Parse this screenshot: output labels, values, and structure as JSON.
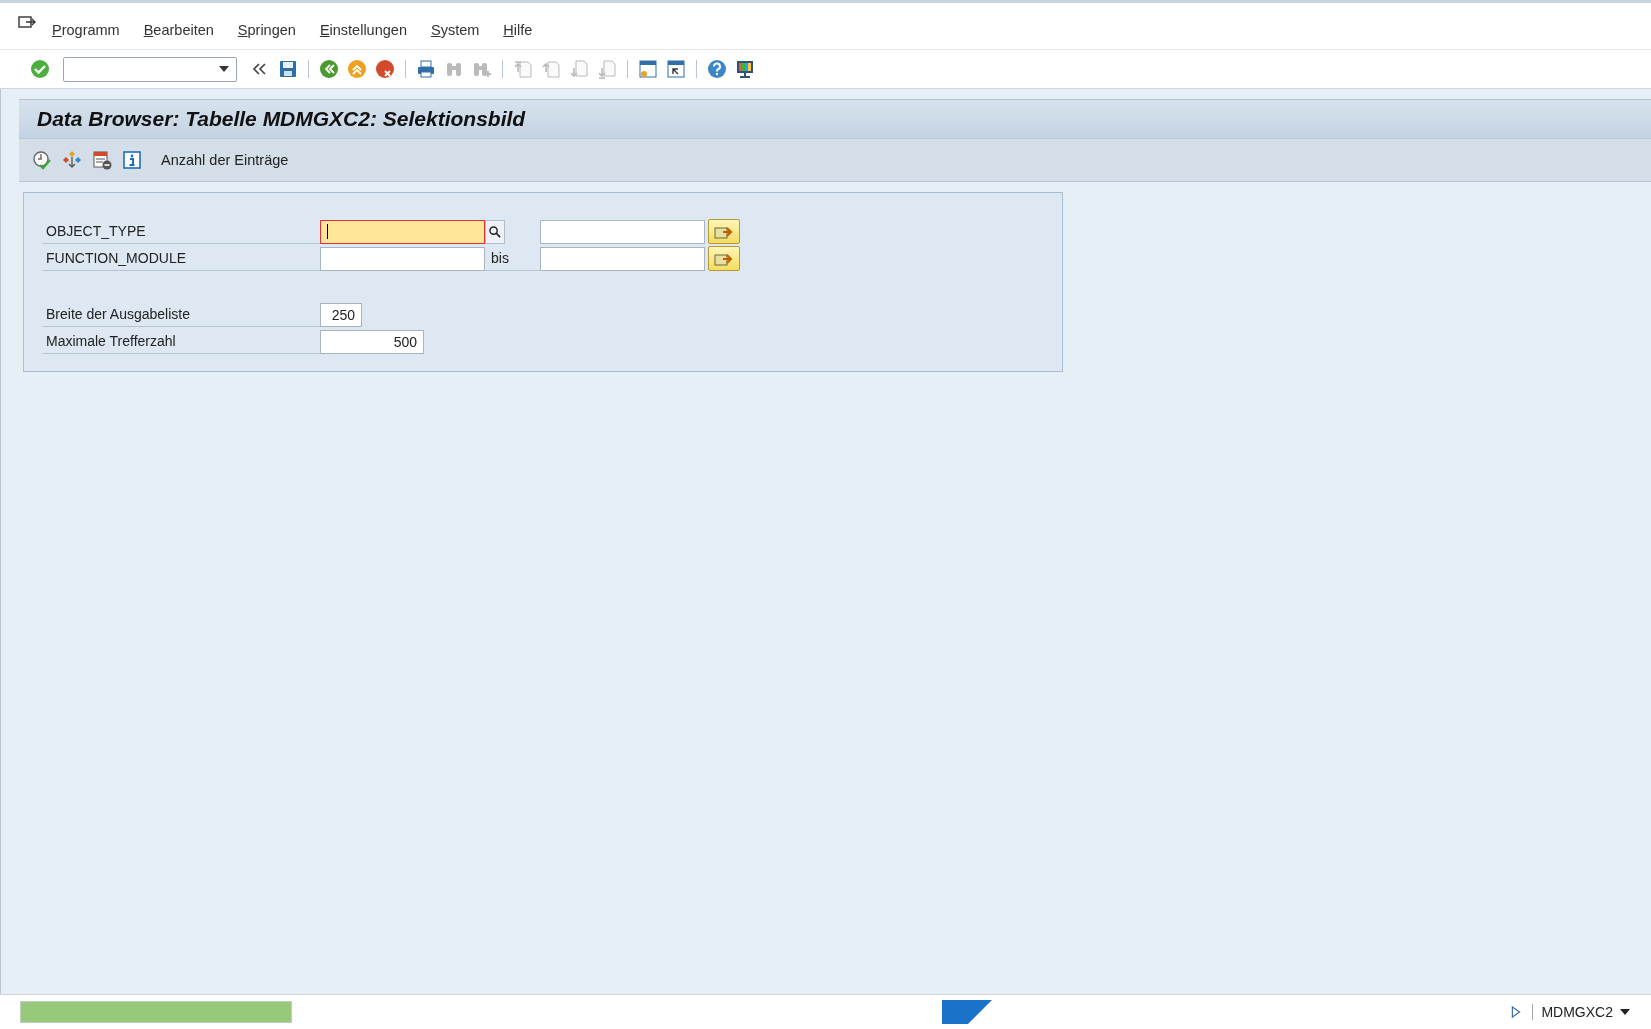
{
  "menu_bar": {
    "items": [
      "Programm",
      "Bearbeiten",
      "Springen",
      "Einstellungen",
      "System",
      "Hilfe"
    ]
  },
  "toolbar": {
    "items": [
      {
        "kind": "enter",
        "disabled": false
      },
      {
        "kind": "command-field"
      },
      {
        "kind": "collapse",
        "disabled": false
      },
      {
        "kind": "save",
        "disabled": false
      },
      {
        "kind": "separator"
      },
      {
        "kind": "back",
        "disabled": false
      },
      {
        "kind": "exit",
        "disabled": false
      },
      {
        "kind": "cancel",
        "disabled": false
      },
      {
        "kind": "separator"
      },
      {
        "kind": "print",
        "disabled": false
      },
      {
        "kind": "find",
        "disabled": true
      },
      {
        "kind": "find-next",
        "disabled": true
      },
      {
        "kind": "separator"
      },
      {
        "kind": "first-page",
        "disabled": true
      },
      {
        "kind": "prev-page",
        "disabled": true
      },
      {
        "kind": "next-page",
        "disabled": true
      },
      {
        "kind": "last-page",
        "disabled": true
      },
      {
        "kind": "separator"
      },
      {
        "kind": "new-session",
        "disabled": false
      },
      {
        "kind": "shortcut",
        "disabled": false
      },
      {
        "kind": "separator"
      },
      {
        "kind": "help",
        "disabled": false
      },
      {
        "kind": "layout",
        "disabled": false
      }
    ]
  },
  "title": "Data Browser: Tabelle MDMGXC2: Selektionsbild",
  "app_toolbar": {
    "icons": [
      {
        "kind": "execute"
      },
      {
        "kind": "connections"
      },
      {
        "kind": "delete-selection"
      },
      {
        "kind": "info"
      }
    ],
    "button": "Anzahl der Einträge"
  },
  "selection": {
    "ranges": [
      {
        "label": "OBJECT_TYPE",
        "focused": true
      },
      {
        "label": "FUNCTION_MODULE",
        "to_label": "bis",
        "focused": false
      }
    ],
    "parameters": [
      {
        "label": "Breite der Ausgabeliste",
        "value": "250",
        "kind": "short"
      },
      {
        "label": "Maximale Trefferzahl",
        "value": "500",
        "kind": "long"
      }
    ]
  },
  "status_bar": {
    "session": "MDMGXC2"
  }
}
